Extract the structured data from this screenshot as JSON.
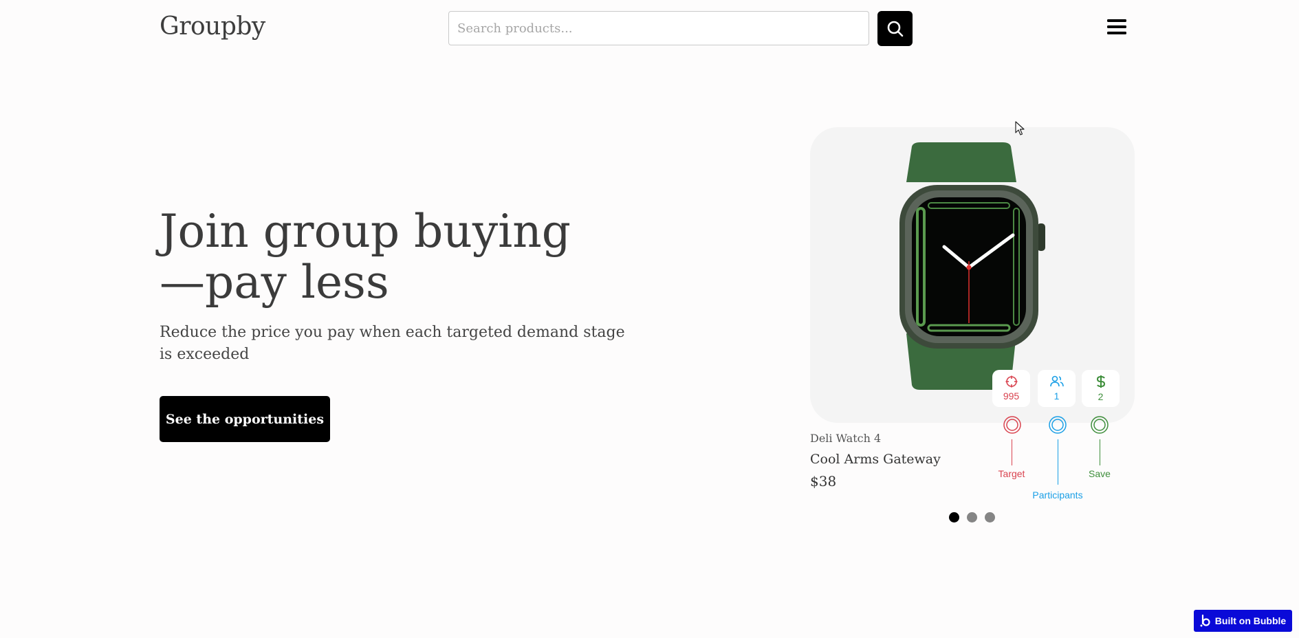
{
  "header": {
    "logo": "Groupby",
    "search_placeholder": "Search products...",
    "search_icon": "search-icon",
    "menu_icon": "hamburger-menu-icon"
  },
  "hero": {
    "title": "Join group buying —pay less",
    "subtitle": "Reduce the price you pay when each targeted demand stage is exceeded",
    "cta_label": "See the opportunities"
  },
  "product": {
    "brand": "Deli Watch 4",
    "name": "Cool Arms Gateway",
    "price": "$38",
    "stats": [
      {
        "icon": "target-icon",
        "value": "995",
        "label": "Target",
        "color": "#d9434f"
      },
      {
        "icon": "users-icon",
        "value": "1",
        "label": "Participants",
        "color": "#1a9fe6"
      },
      {
        "icon": "dollar-icon",
        "value": "2",
        "label": "Save",
        "color": "#3e8e3b"
      }
    ]
  },
  "carousel": {
    "active_index": 0,
    "dot_count": 3,
    "active_color": "#000000",
    "inactive_color": "#858585"
  },
  "badge": {
    "label": "Built on Bubble",
    "color": "#0a0ad8"
  }
}
